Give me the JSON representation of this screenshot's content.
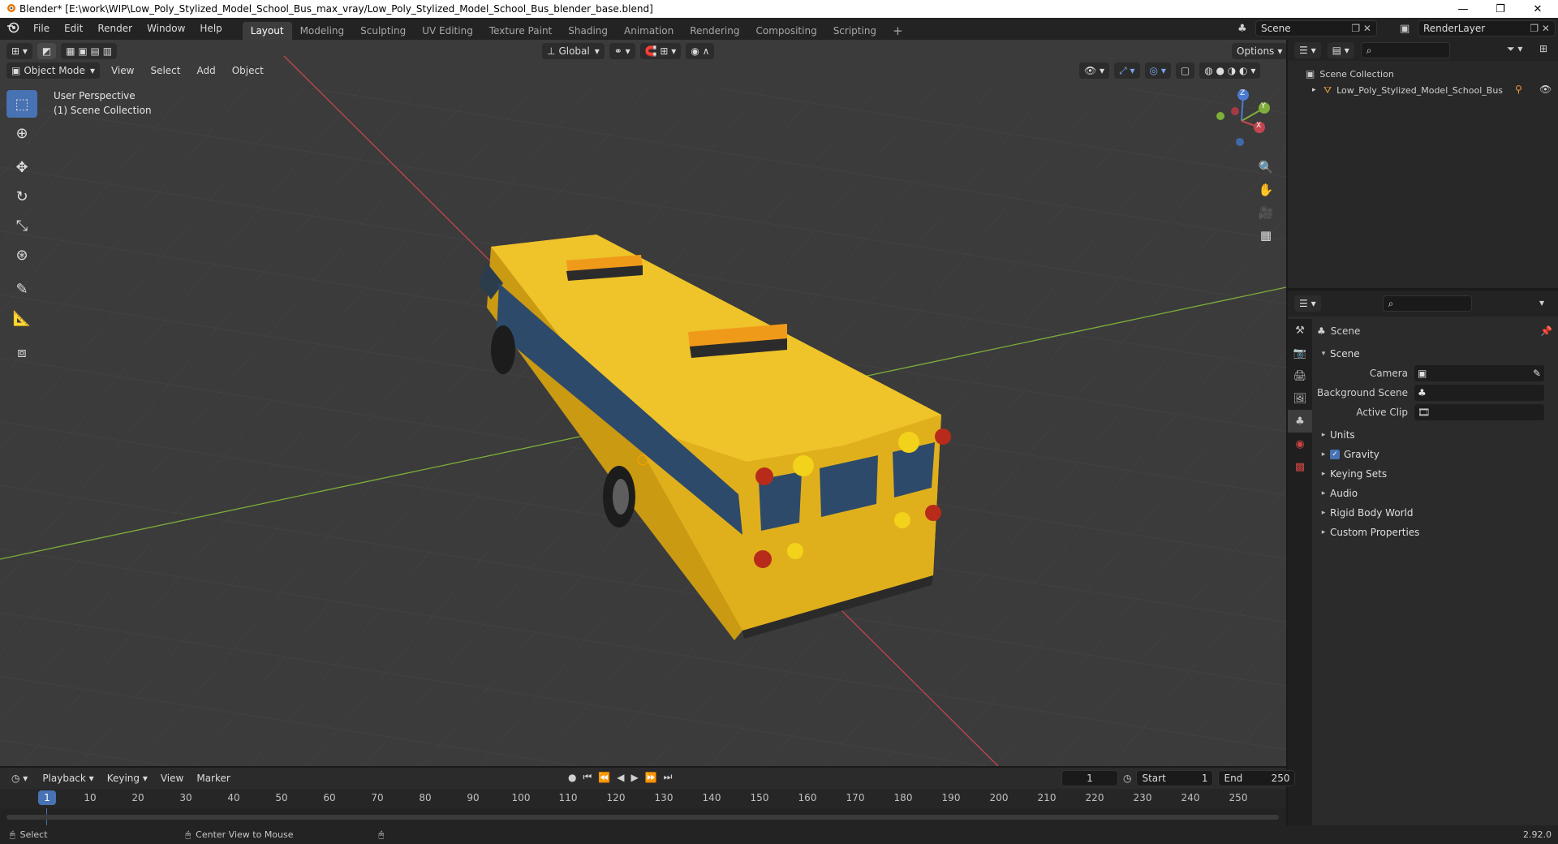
{
  "window": {
    "title": "Blender* [E:\\work\\WIP\\Low_Poly_Stylized_Model_School_Bus_max_vray/Low_Poly_Stylized_Model_School_Bus_blender_base.blend]",
    "minimize": "—",
    "maximize": "❐",
    "close": "✕"
  },
  "menu": {
    "items": [
      "File",
      "Edit",
      "Render",
      "Window",
      "Help"
    ]
  },
  "workspaces": {
    "tabs": [
      "Layout",
      "Modeling",
      "Sculpting",
      "UV Editing",
      "Texture Paint",
      "Shading",
      "Animation",
      "Rendering",
      "Compositing",
      "Scripting"
    ],
    "active": "Layout",
    "add": "+"
  },
  "scene_selector": {
    "value": "Scene"
  },
  "renderlayer_selector": {
    "value": "RenderLayer"
  },
  "viewport": {
    "mode": "Object Mode",
    "menus": [
      "View",
      "Select",
      "Add",
      "Object"
    ],
    "orientation": "Global",
    "options_label": "Options",
    "overlay_line1": "User Perspective",
    "overlay_line2": "(1) Scene Collection",
    "gizmo_axes": [
      "X",
      "Y",
      "Z"
    ],
    "colors": {
      "background": "#3b3b3b",
      "grid": "#4a4a4a",
      "x_axis": "#c4454f",
      "y_axis": "#7fae3a",
      "bus_body": "#e6b51e",
      "bus_window": "#2e4a6a"
    }
  },
  "outliner": {
    "search_placeholder": "",
    "root": "Scene Collection",
    "items": [
      {
        "name": "Low_Poly_Stylized_Model_School_Bus"
      }
    ]
  },
  "properties": {
    "breadcrumb": "Scene",
    "panel_title": "Scene",
    "fields": [
      {
        "label": "Camera",
        "value": ""
      },
      {
        "label": "Background Scene",
        "value": ""
      },
      {
        "label": "Active Clip",
        "value": ""
      }
    ],
    "subpanels": [
      "Units",
      "Gravity",
      "Keying Sets",
      "Audio",
      "Rigid Body World",
      "Custom Properties"
    ],
    "gravity_checked": true
  },
  "timeline": {
    "menus": [
      "Playback",
      "Keying",
      "View",
      "Marker"
    ],
    "current_frame": "1",
    "start_label": "Start",
    "start": "1",
    "end_label": "End",
    "end": "250",
    "ticks": [
      "10",
      "20",
      "30",
      "40",
      "50",
      "60",
      "70",
      "80",
      "90",
      "100",
      "110",
      "120",
      "130",
      "140",
      "150",
      "160",
      "170",
      "180",
      "190",
      "200",
      "210",
      "220",
      "230",
      "240",
      "250"
    ],
    "playhead": "1"
  },
  "statusbar": {
    "select": "Select",
    "center": "Center View to Mouse",
    "version": "2.92.0"
  }
}
